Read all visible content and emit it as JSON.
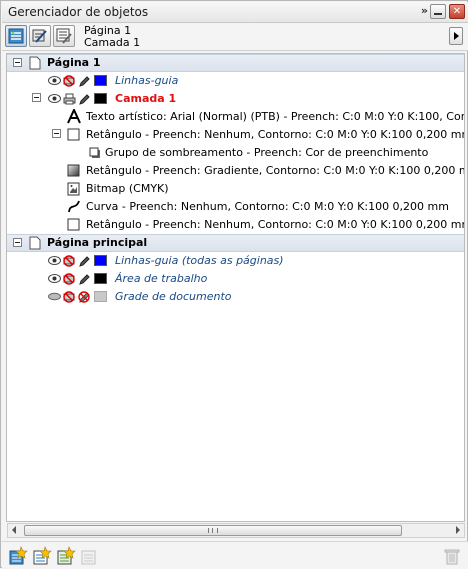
{
  "window": {
    "title": "Gerenciador de objetos"
  },
  "toolbar": {
    "page_name": "Página 1",
    "layer_name": "Camada 1"
  },
  "tree": [
    {
      "type": "page",
      "label": "Página 1"
    },
    {
      "type": "layer",
      "label": "Linhas-guia",
      "style": "italic",
      "swatch": "#0000ff"
    },
    {
      "type": "layer",
      "label": "Camada 1",
      "style": "active",
      "swatch": "#000000"
    },
    {
      "type": "object",
      "label": "Texto artístico: Arial (Normal) (PTB) - Preench: C:0 M:0 Y:0 K:100, Contorno",
      "icon": "text-icon"
    },
    {
      "type": "object",
      "label": "Retângulo - Preench: Nenhum, Contorno: C:0 M:0 Y:0 K:100  0,200 mm",
      "icon": "rectangle-icon"
    },
    {
      "type": "object",
      "label": "Grupo de sombreamento - Preench: Cor de preenchimento",
      "icon": "shadow-group-icon"
    },
    {
      "type": "object",
      "label": "Retângulo - Preench: Gradiente, Contorno: C:0 M:0 Y:0 K:100  0,200 mm",
      "icon": "gradient-rectangle-icon"
    },
    {
      "type": "object",
      "label": "Bitmap (CMYK)",
      "icon": "bitmap-icon"
    },
    {
      "type": "object",
      "label": "Curva - Preench: Nenhum, Contorno: C:0 M:0 Y:0 K:100  0,200 mm",
      "icon": "curve-icon"
    },
    {
      "type": "object",
      "label": "Retângulo - Preench: Nenhum, Contorno: C:0 M:0 Y:0 K:100  0,200 mm",
      "icon": "rectangle-icon"
    },
    {
      "type": "page",
      "label": "Página principal"
    },
    {
      "type": "layer",
      "label": "Linhas-guia (todas as páginas)",
      "style": "italic",
      "swatch": "#0000ff"
    },
    {
      "type": "layer",
      "label": "Área de trabalho",
      "style": "italic",
      "swatch": "#000000"
    },
    {
      "type": "layer",
      "label": "Grade de documento",
      "style": "italic",
      "swatch": "#c8c8c8"
    }
  ],
  "colors": {
    "active_layer": "#e01010",
    "master_layer_text": "#1a4a86",
    "header_bg": "#dde4ee"
  }
}
